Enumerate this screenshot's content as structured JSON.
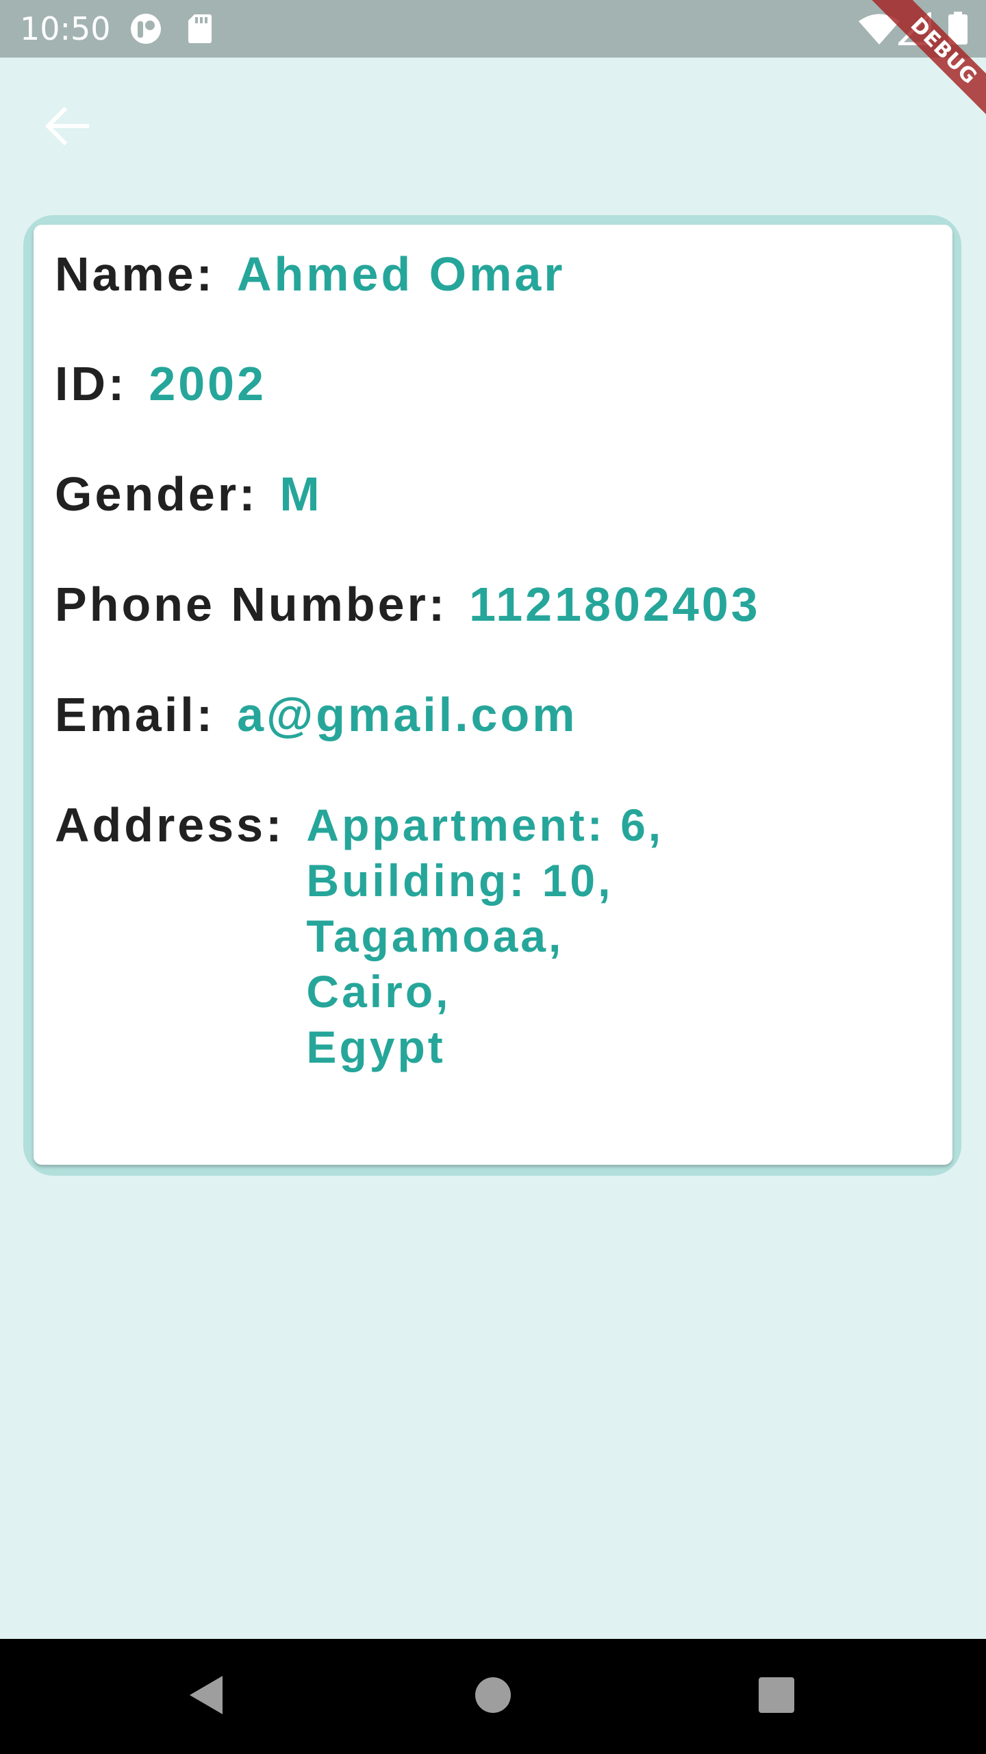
{
  "status_bar": {
    "time": "10:50",
    "icons": [
      "media-icon",
      "sd-card-icon",
      "wifi-icon",
      "cell-signal-icon",
      "battery-icon"
    ]
  },
  "debug_banner": {
    "label": "DEBUG"
  },
  "app_bar": {
    "back_icon": "arrow-back-icon"
  },
  "profile": {
    "name_label": "Name:",
    "name_value": "Ahmed Omar",
    "id_label": "ID:",
    "id_value": "2002",
    "gender_label": "Gender:",
    "gender_value": "M",
    "phone_label": "Phone Number:",
    "phone_value": "1121802403",
    "email_label": "Email:",
    "email_value": "a@gmail.com",
    "address_label": "Address:",
    "address_lines": [
      "Appartment: 6,",
      "Building: 10,",
      "Tagamoaa,",
      "Cairo,",
      "Egypt"
    ]
  },
  "nav_bar": {
    "buttons": [
      "back-triangle-icon",
      "home-circle-icon",
      "recents-square-icon"
    ]
  },
  "colors": {
    "background": "#e0f2f1",
    "card_border": "#b2dfdb",
    "label_text": "#212121",
    "value_text": "#26a69a",
    "status_bar": "#a3b3b2",
    "debug_banner": "#a52323"
  }
}
